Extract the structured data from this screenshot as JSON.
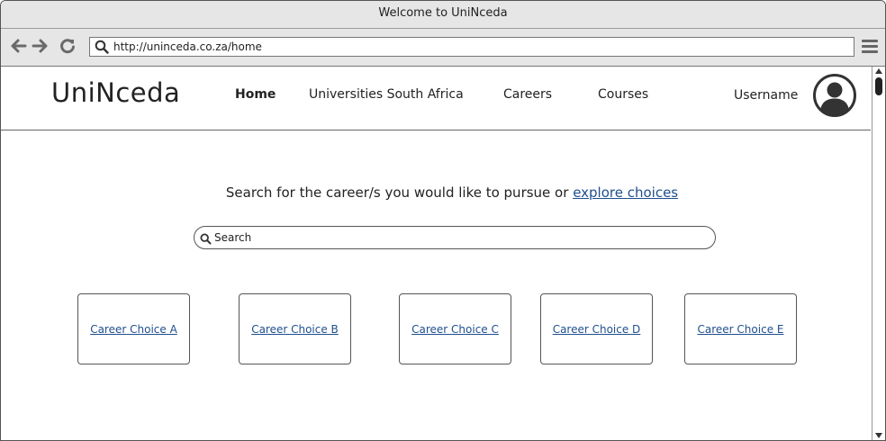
{
  "window": {
    "title": "Welcome to UniNceda"
  },
  "browser": {
    "url": "http://uninceda.co.za/home",
    "icons": {
      "back": "back-arrow-icon",
      "forward": "forward-arrow-icon",
      "reload": "reload-icon",
      "menu": "hamburger-menu-icon"
    }
  },
  "header": {
    "logo": "UniNceda",
    "nav": [
      {
        "label": "Home",
        "active": true
      },
      {
        "label": "Universities South Africa",
        "active": false
      },
      {
        "label": "Careers",
        "active": false
      },
      {
        "label": "Courses",
        "active": false
      }
    ],
    "username": "Username",
    "avatar_icon": "user-avatar-icon"
  },
  "main": {
    "prompt_text": "Search for the career/s you would like to pursue or",
    "prompt_link": "explore choices",
    "search_placeholder": "Search",
    "cards": [
      {
        "label": "Career Choice A"
      },
      {
        "label": "Career Choice B"
      },
      {
        "label": "Career Choice C"
      },
      {
        "label": "Career Choice D"
      },
      {
        "label": "Career Choice E"
      }
    ]
  },
  "colors": {
    "link": "#1f4f8f",
    "chrome": "#e6e6e6",
    "border": "#555555"
  }
}
